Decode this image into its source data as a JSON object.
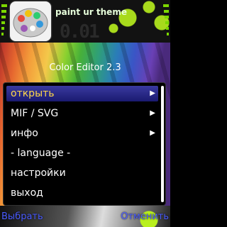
{
  "header": {
    "title": "paint ur theme",
    "clock": "0.01"
  },
  "app": {
    "subtitle": "Color Editor  2.3"
  },
  "menu": {
    "items": [
      {
        "label": "открыть",
        "has_submenu": true,
        "selected": true
      },
      {
        "label": "MIF / SVG",
        "has_submenu": true,
        "selected": false
      },
      {
        "label": "инфо",
        "has_submenu": true,
        "selected": false
      },
      {
        "label": "- language -",
        "has_submenu": false,
        "selected": false
      },
      {
        "label": "настройки",
        "has_submenu": false,
        "selected": false
      },
      {
        "label": "выход",
        "has_submenu": false,
        "selected": false
      }
    ],
    "arrow_glyph": "▶"
  },
  "softkeys": {
    "left": "Выбрать",
    "right": "Отменить"
  },
  "colors": {
    "selection": "#2a2a90",
    "softkey": "#4a5cff",
    "signal": "#7cd800"
  }
}
